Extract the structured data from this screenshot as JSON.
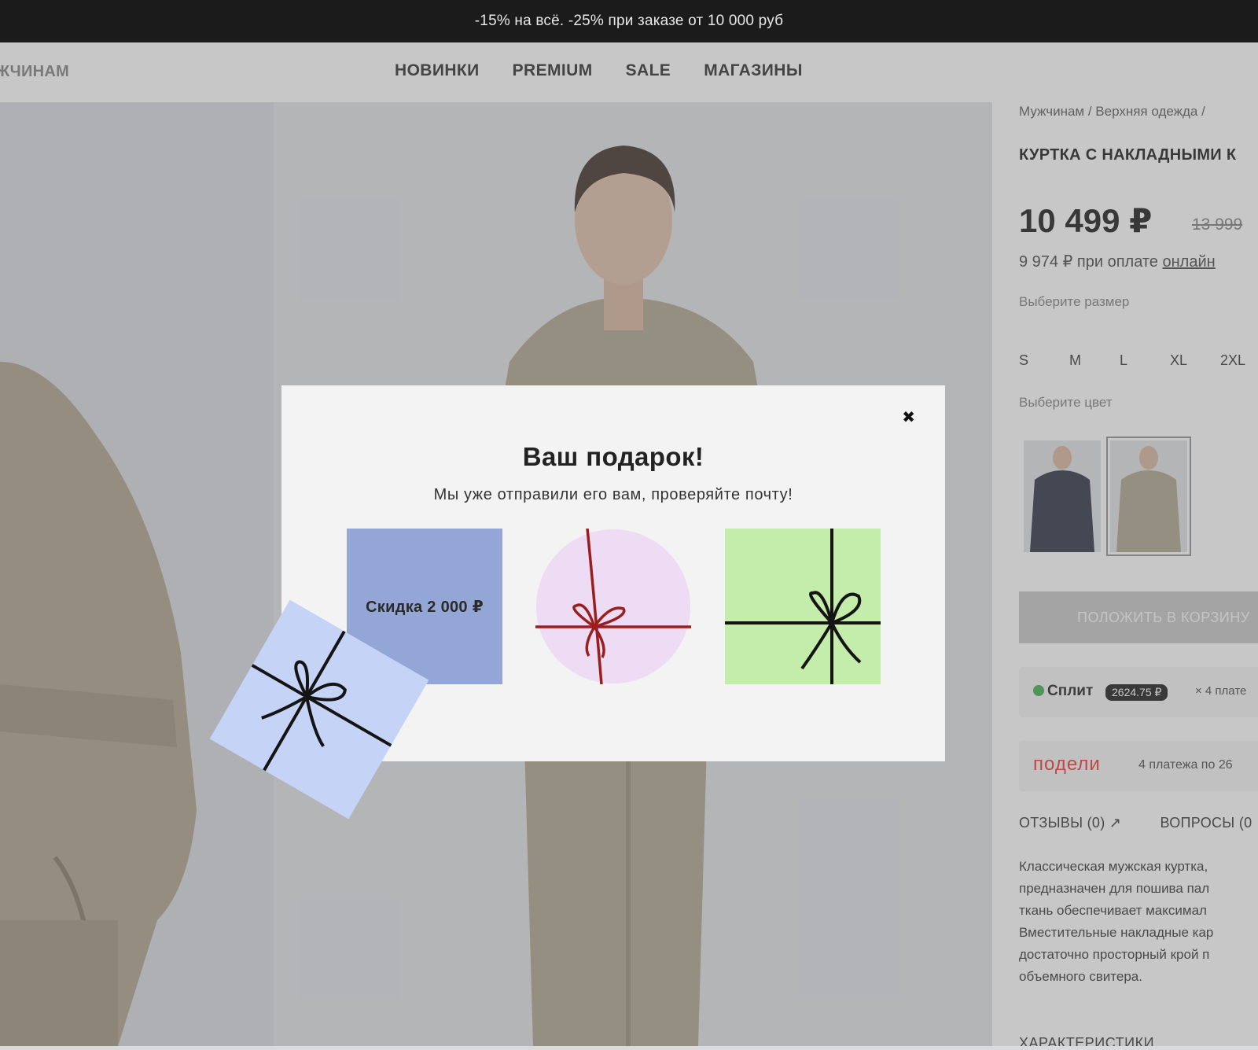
{
  "promo_bar": {
    "text": "-15% на всё. -25% при заказе от 10 000 руб"
  },
  "nav": {
    "cut_item": "ЖЧИНАМ",
    "items": [
      {
        "label": "НОВИНКИ"
      },
      {
        "label": "PREMIUM"
      },
      {
        "label": "SALE"
      },
      {
        "label": "МАГАЗИНЫ"
      }
    ]
  },
  "product": {
    "breadcrumb": "Мужчинам / Верхняя одежда /",
    "title": "КУРТКА С НАКЛАДНЫМИ К",
    "price": "10 499 ₽",
    "old_price": "13 999",
    "online_price": "9 974 ₽ при оплате",
    "online_link": "онлайн",
    "size_label": "Выберите размер",
    "sizes": [
      "S",
      "M",
      "L",
      "XL",
      "2XL"
    ],
    "color_label": "Выберите цвет",
    "cart_button": "ПОЛОЖИТЬ В КОРЗИНУ",
    "split": {
      "logo": "Сплит",
      "amount": "2624.75 ₽",
      "rest": "× 4 плате"
    },
    "podeli": {
      "logo": "подели",
      "rest": "4 платежа по 26"
    },
    "tabs": [
      "ОТЗЫВЫ (0) ↗",
      "ВОПРОСЫ (0"
    ],
    "description_lines": [
      "Классическая мужская куртка,",
      "предназначен для пошива пал",
      "ткань обеспечивает максимал",
      "Вместительные накладные кар",
      "достаточно просторный крой п",
      "объемного свитера."
    ],
    "characteristics": "ХАРАКТЕРИСТИКИ"
  },
  "modal": {
    "close": "✖",
    "title": "Ваш подарок!",
    "subtitle": "Мы уже отправили его вам, проверяйте почту!",
    "discount_label": "Скидка 2 000 ₽"
  },
  "colors": {
    "promo_bg": "#1b1b1b",
    "discount_card": "#93a6d5",
    "circle_card": "#eddcf3",
    "green_card": "#c4edab",
    "floating_card": "#c5d3f7",
    "ribbon_red": "#9b1e1e",
    "ribbon_dark": "#141414",
    "podeli_red": "#e0312f"
  }
}
